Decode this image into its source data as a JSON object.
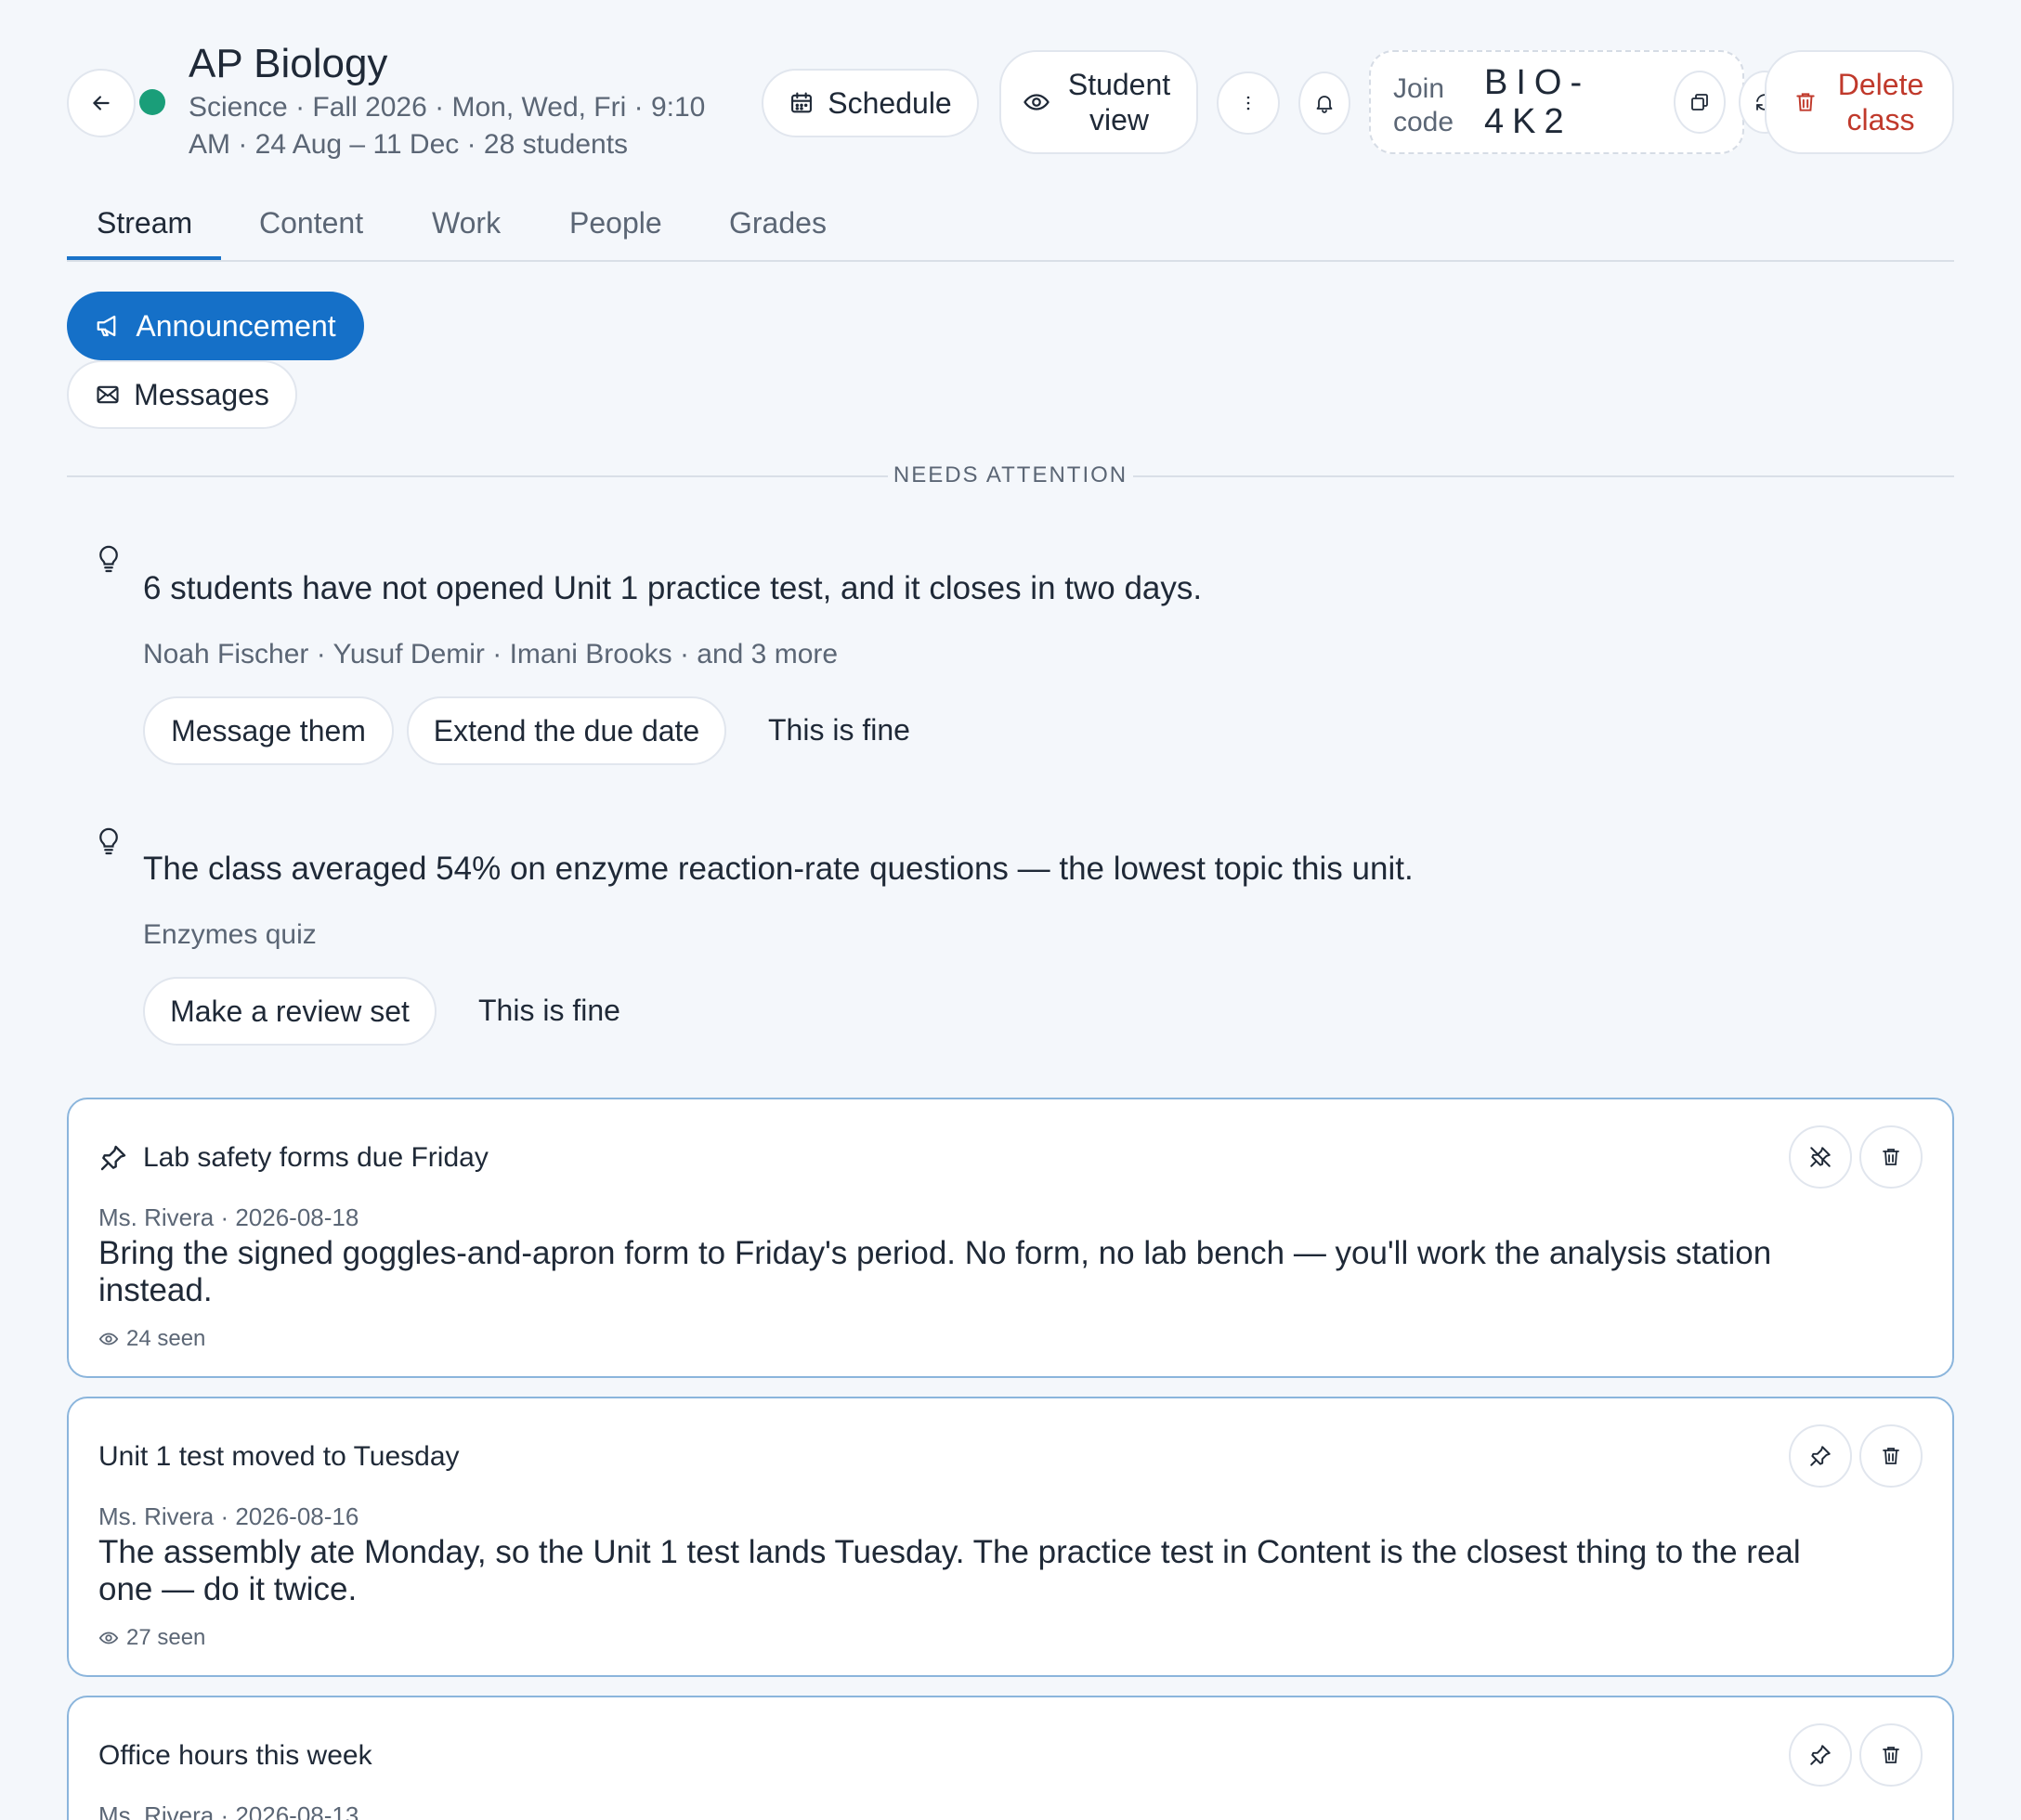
{
  "header": {
    "class_title": "AP Biology",
    "class_meta": "Science · Fall 2026 · Mon, Wed, Fri · 9:10 AM · 24 Aug – 11 Dec · 28 students",
    "schedule_label": "Schedule",
    "student_view_label": "Student view",
    "join_label": "Join code",
    "join_code": "BIO-4K2",
    "delete_label": "Delete class",
    "status_color": "#1a9e79"
  },
  "tabs": [
    {
      "label": "Stream",
      "active": true
    },
    {
      "label": "Content",
      "active": false
    },
    {
      "label": "Work",
      "active": false
    },
    {
      "label": "People",
      "active": false
    },
    {
      "label": "Grades",
      "active": false
    }
  ],
  "composer": {
    "announcement_label": "Announcement",
    "messages_label": "Messages"
  },
  "needs_attention": {
    "heading": "NEEDS ATTENTION",
    "insights": [
      {
        "text": "6 students have not opened Unit 1 practice test, and it closes in two days.",
        "detail": "Noah Fischer · Yusuf Demir · Imani Brooks · and 3 more",
        "actions": [
          "Message them",
          "Extend the due date",
          "This is fine"
        ]
      },
      {
        "text": "The class averaged 54% on enzyme reaction-rate questions — the lowest topic this unit.",
        "detail": "Enzymes quiz",
        "actions": [
          "Make a review set",
          "This is fine"
        ]
      }
    ]
  },
  "announcements": [
    {
      "title": "Lab safety forms due Friday",
      "pinned": true,
      "meta": "Ms. Rivera · 2026-08-18",
      "body": "Bring the signed goggles-and-apron form to Friday's period. No form, no lab bench — you'll work the analysis station instead.",
      "seen": "24 seen"
    },
    {
      "title": "Unit 1 test moved to Tuesday",
      "pinned": false,
      "meta": "Ms. Rivera · 2026-08-16",
      "body": "The assembly ate Monday, so the Unit 1 test lands Tuesday. The practice test in Content is the closest thing to the real one — do it twice.",
      "seen": "27 seen"
    },
    {
      "title": "Office hours this week",
      "pinned": false,
      "meta": "Ms. Rivera · 2026-08-13"
    }
  ],
  "colors": {
    "accent": "#1570c8",
    "danger": "#c0392b",
    "card_border": "#8bb5dc",
    "background": "#f4f7fb"
  }
}
